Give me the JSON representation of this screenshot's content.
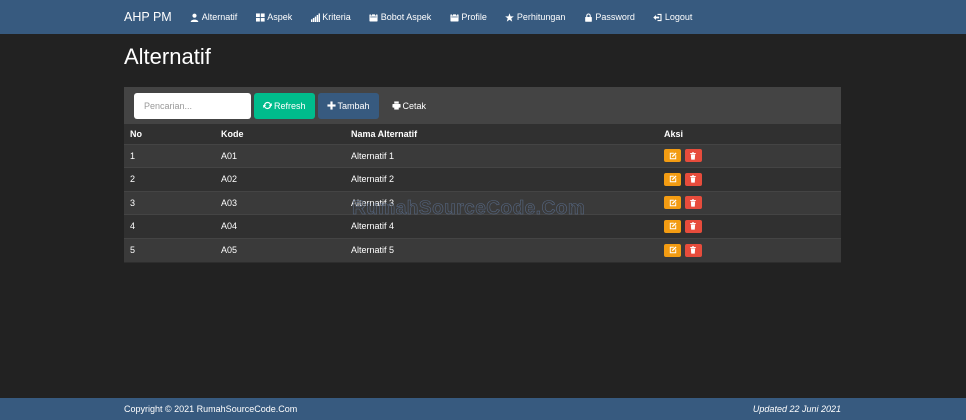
{
  "navbar": {
    "brand": "AHP PM",
    "items": [
      {
        "label": "Alternatif",
        "icon": "user-icon"
      },
      {
        "label": "Aspek",
        "icon": "grid-icon"
      },
      {
        "label": "Kriteria",
        "icon": "signal-icon"
      },
      {
        "label": "Bobot Aspek",
        "icon": "calendar-icon"
      },
      {
        "label": "Profile",
        "icon": "calendar-icon"
      },
      {
        "label": "Perhitungan",
        "icon": "star-icon"
      },
      {
        "label": "Password",
        "icon": "lock-icon"
      },
      {
        "label": "Logout",
        "icon": "logout-icon"
      }
    ]
  },
  "page": {
    "title": "Alternatif"
  },
  "toolbar": {
    "search_placeholder": "Pencarian...",
    "refresh_label": "Refresh",
    "tambah_label": "Tambah",
    "cetak_label": "Cetak"
  },
  "table": {
    "headers": [
      "No",
      "Kode",
      "Nama Alternatif",
      "Aksi"
    ],
    "rows": [
      [
        "1",
        "A01",
        "Alternatif 1"
      ],
      [
        "2",
        "A02",
        "Alternatif 2"
      ],
      [
        "3",
        "A03",
        "Alternatif 3"
      ],
      [
        "4",
        "A04",
        "Alternatif 4"
      ],
      [
        "5",
        "A05",
        "Alternatif 5"
      ]
    ]
  },
  "watermark": "RumahSourceCode.Com",
  "footer": {
    "copyright": "Copyright © 2021 RumahSourceCode.Com",
    "updated": "Updated 22 Juni 2021"
  },
  "colors": {
    "navbar": "#375a7f",
    "background": "#222222",
    "refresh": "#00bc8c",
    "edit": "#f39c12",
    "delete": "#e74c3c"
  }
}
